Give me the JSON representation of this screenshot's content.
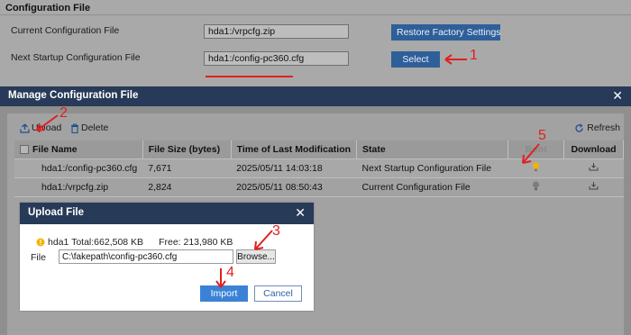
{
  "page": {
    "section_title": "Configuration File",
    "current_label": "Current Configuration File",
    "current_value": "hda1:/vrpcfg.zip",
    "next_label": "Next Startup Configuration File",
    "next_value": "hda1:/config-pc360.cfg",
    "restore_button": "Restore Factory Settings",
    "select_button": "Select"
  },
  "manage_dialog": {
    "title": "Manage Configuration File",
    "upload_label": "Upload",
    "delete_label": "Delete",
    "refresh_label": "Refresh",
    "columns": [
      "File Name",
      "File Size (bytes)",
      "Time of Last Modification",
      "State",
      "Boot",
      "Download"
    ],
    "rows": [
      {
        "name": "hda1:/config-pc360.cfg",
        "size": "7,671",
        "time": "2025/05/11 14:03:18",
        "state": "Next Startup Configuration File",
        "boot": "active"
      },
      {
        "name": "hda1:/vrpcfg.zip",
        "size": "2,824",
        "time": "2025/05/11 08:50:43",
        "state": "Current Configuration File",
        "boot": "inactive"
      }
    ]
  },
  "upload_dialog": {
    "title": "Upload File",
    "disk": "hda1 Total:662,508 KB",
    "free": "Free: 213,980 KB",
    "file_label": "File",
    "file_value": "C:\\fakepath\\config-pc360.cfg",
    "browse_button": "Browse...",
    "import_button": "Import",
    "cancel_button": "Cancel"
  },
  "annotations": [
    "1",
    "2",
    "3",
    "4",
    "5"
  ],
  "colors": {
    "header_bg": "#273a57",
    "primary_button": "#3b82d6",
    "annotation_red": "#e02020",
    "bulb_active": "#f0b400"
  }
}
